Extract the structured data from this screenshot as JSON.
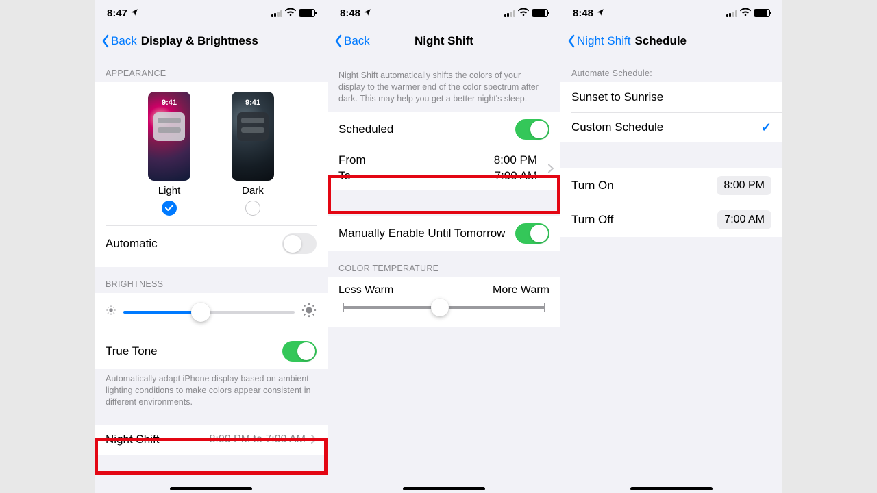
{
  "screens": {
    "display": {
      "status_time": "8:47",
      "back": "Back",
      "title": "Display & Brightness",
      "appearance_header": "Appearance",
      "light_label": "Light",
      "dark_label": "Dark",
      "preview_clock": "9:41",
      "automatic_label": "Automatic",
      "brightness_header": "Brightness",
      "truetone_label": "True Tone",
      "truetone_footer": "Automatically adapt iPhone display based on ambient lighting conditions to make colors appear consistent in different environments.",
      "nightshift_label": "Night Shift",
      "nightshift_value": "8:00 PM to 7:00 AM"
    },
    "nightshift": {
      "status_time": "8:48",
      "back": "Back",
      "title": "Night Shift",
      "intro": "Night Shift automatically shifts the colors of your display to the warmer end of the color spectrum after dark. This may help you get a better night's sleep.",
      "scheduled_label": "Scheduled",
      "from_label": "From",
      "from_value": "8:00 PM",
      "to_label": "To",
      "to_value": "7:00 AM",
      "manual_label": "Manually Enable Until Tomorrow",
      "colortemp_header": "Color Temperature",
      "less_warm": "Less Warm",
      "more_warm": "More Warm"
    },
    "schedule": {
      "status_time": "8:48",
      "back": "Night Shift",
      "title": "Schedule",
      "automate_header": "Automate Schedule:",
      "sunset": "Sunset to Sunrise",
      "custom": "Custom Schedule",
      "turn_on_label": "Turn On",
      "turn_on_value": "8:00 PM",
      "turn_off_label": "Turn Off",
      "turn_off_value": "7:00 AM"
    }
  }
}
